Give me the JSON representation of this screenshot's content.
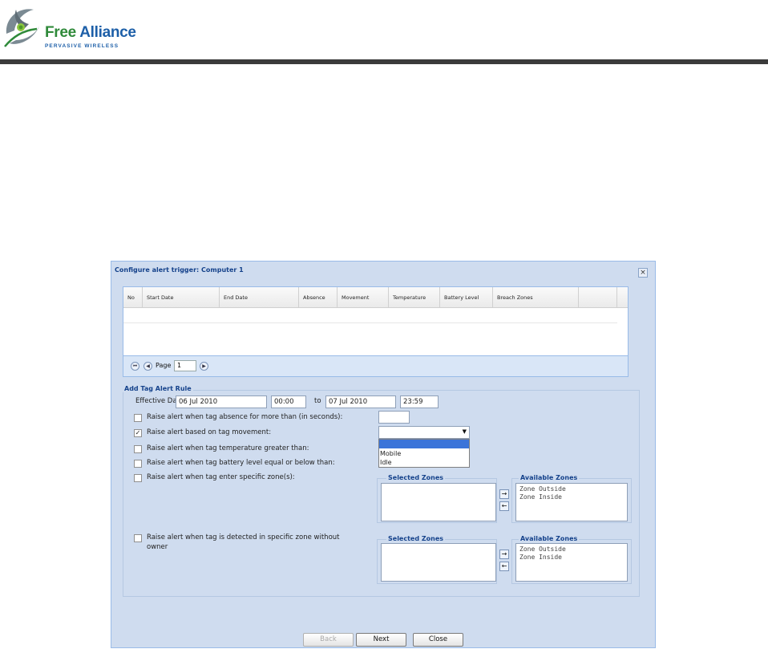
{
  "brand": {
    "name_part1": "Free",
    "name_part2": "Alliance",
    "tagline": "PERVASIVE WIRELESS"
  },
  "dialog": {
    "title": "Configure alert trigger: Computer 1",
    "close_glyph": "×"
  },
  "grid": {
    "columns": [
      "No",
      "Start Date",
      "End Date",
      "Absence",
      "Movement",
      "Temperature",
      "Battery Level",
      "Breach Zones",
      ""
    ],
    "rows": []
  },
  "pager": {
    "first_glyph": "⏮",
    "prev_glyph": "◀",
    "next_glyph": "▶",
    "page_label": "Page",
    "page_value": "1"
  },
  "rule": {
    "legend": "Add Tag Alert Rule",
    "effective_label": "Effective Date:",
    "start_date": "06 Jul 2010",
    "start_time": "00:00",
    "to_label": "to",
    "end_date": "07 Jul 2010",
    "end_time": "23:59",
    "options": [
      {
        "label": "Raise alert when tag absence for more than (in seconds):",
        "checked": false
      },
      {
        "label": "Raise alert based on tag movement:",
        "checked": true
      },
      {
        "label": "Raise alert when tag temperature greater than:",
        "checked": false
      },
      {
        "label": "Raise alert when tag battery level equal or below than:",
        "checked": false
      },
      {
        "label": "Raise alert when tag enter specific zone(s):",
        "checked": false
      }
    ],
    "absence_value": "",
    "movement_value": "",
    "movement_options": [
      "",
      "Mobile",
      "Idle"
    ],
    "owner_label_line1": "Raise alert when tag is detected in specific zone without",
    "owner_label_line2": "owner",
    "owner_checked": false,
    "check_glyph": "✓",
    "dd_arrow": "▼"
  },
  "zones": {
    "selected_legend": "Selected Zones",
    "available_legend": "Available Zones",
    "available": [
      "Zone Outside",
      "Zone Inside"
    ],
    "add_glyph": "→",
    "remove_glyph": "←"
  },
  "buttons": {
    "back": "Back",
    "next": "Next",
    "close": "Close"
  },
  "colors": {
    "dialog_bg": "#cfdcef",
    "accent_title": "#15428b",
    "selection": "#3b74d9"
  }
}
